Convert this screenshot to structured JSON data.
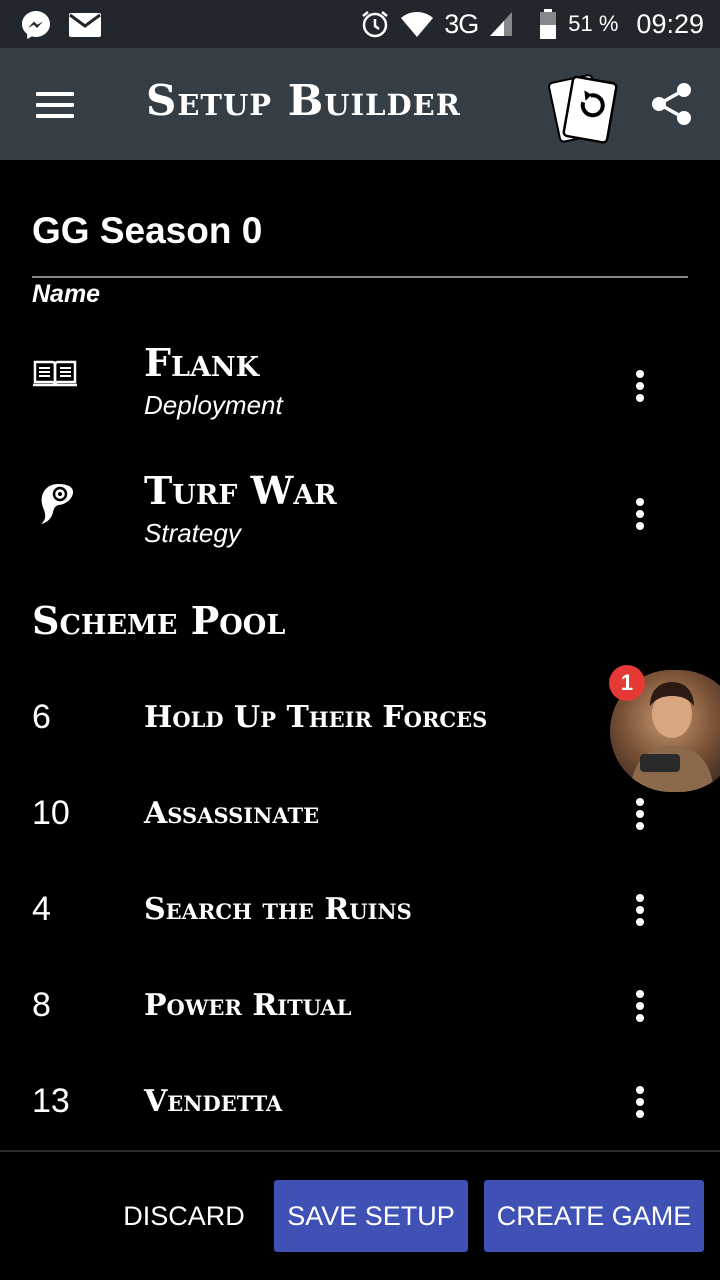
{
  "status_bar": {
    "network": "3G",
    "battery": "51 %",
    "time": "09:29",
    "icons": [
      "messenger-icon",
      "mail-icon",
      "alarm-icon",
      "wifi-icon",
      "signal-icon",
      "battery-icon"
    ]
  },
  "app_bar": {
    "title": "Setup Builder"
  },
  "setup": {
    "name": "GG Season 0",
    "name_label": "Name"
  },
  "deployment": {
    "title": "Flank",
    "subtitle": "Deployment",
    "icon": "book-icon"
  },
  "strategy": {
    "title": "Turf War",
    "subtitle": "Strategy",
    "icon": "ram-head-icon"
  },
  "scheme_pool": {
    "title": "Scheme Pool",
    "items": [
      {
        "number": "6",
        "title": "Hold Up Their Forces"
      },
      {
        "number": "10",
        "title": "Assassinate"
      },
      {
        "number": "4",
        "title": "Search the Ruins"
      },
      {
        "number": "8",
        "title": "Power Ritual"
      },
      {
        "number": "13",
        "title": "Vendetta"
      }
    ]
  },
  "chat_head": {
    "badge_count": "1",
    "badge_color": "#e53935"
  },
  "actions": {
    "discard": "DISCARD",
    "save": "SAVE SETUP",
    "create": "CREATE GAME",
    "primary_color": "#3f51b5"
  }
}
